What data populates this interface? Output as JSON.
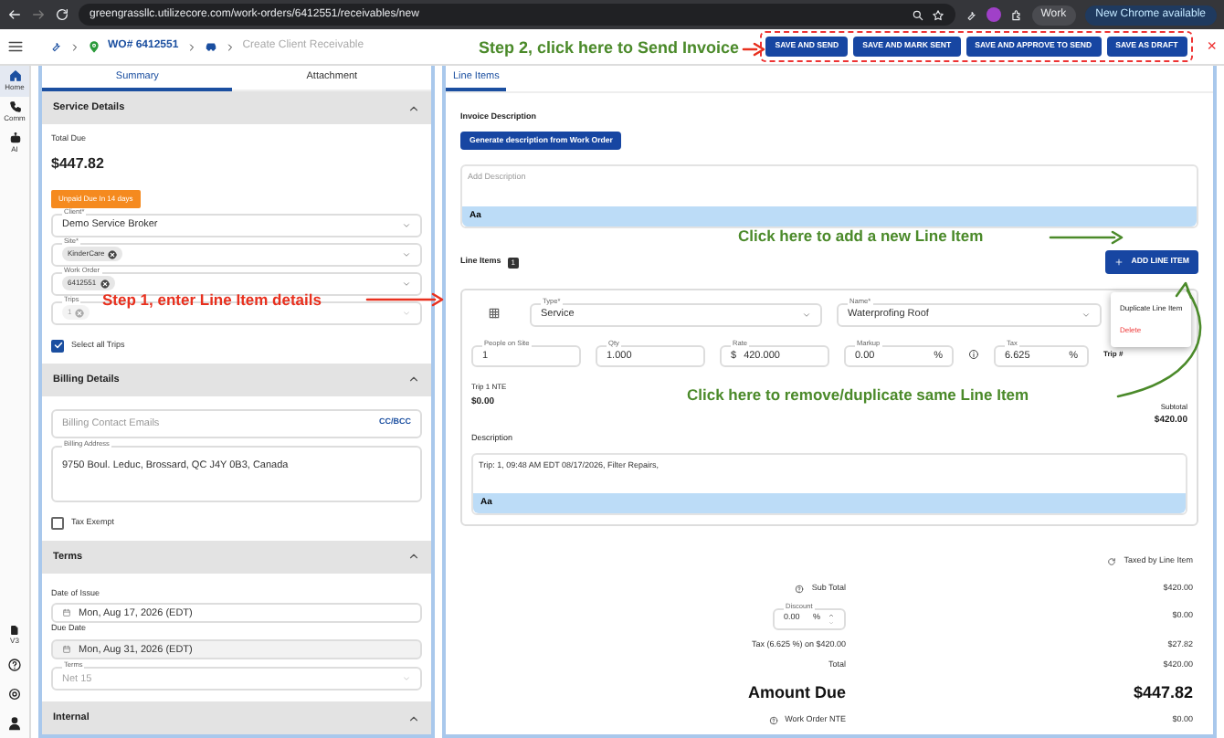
{
  "browser": {
    "url": "greengrassllc.utilizecore.com/work-orders/6412551/receivables/new",
    "profile": "Work",
    "update_button": "New Chrome available"
  },
  "breadcrumb": {
    "work_order": "WO# 6412551",
    "page": "Create Client Receivable"
  },
  "actions": [
    "SAVE AND SEND",
    "SAVE AND MARK SENT",
    "SAVE AND APPROVE TO SEND",
    "SAVE AS DRAFT"
  ],
  "close": "×",
  "rail": [
    {
      "label": "Home",
      "selected": true
    },
    {
      "label": "Comm",
      "selected": false
    },
    {
      "label": "AI",
      "selected": false
    }
  ],
  "rail_version": "V3",
  "left_tabs": [
    {
      "label": "Summary",
      "selected": true
    },
    {
      "label": "Attachment",
      "selected": false
    }
  ],
  "service_details": {
    "title": "Service Details",
    "expanded": true,
    "total_due_label": "Total Due",
    "total_due": "$447.82",
    "status_badge": "Unpaid Due In 14 days",
    "client_label": "Client*",
    "client": "Demo Service Broker",
    "site_label": "Site*",
    "site_chips": [
      "KinderCare"
    ],
    "work_order_label": "Work Order",
    "work_order_chips": [
      "6412551"
    ],
    "trips_label": "Trips",
    "trips_chips": [
      "1"
    ],
    "trips_disabled": true,
    "select_all_trips": {
      "label": "Select all Trips",
      "checked": true
    }
  },
  "billing_details": {
    "title": "Billing Details",
    "expanded": true,
    "emails_placeholder": "Billing Contact Emails",
    "cc_bcc": "CC/BCC",
    "address_label": "Billing Address",
    "address": "9750 Boul. Leduc, Brossard, QC J4Y 0B3, Canada",
    "tax_exempt": {
      "label": "Tax Exempt",
      "checked": false
    }
  },
  "terms": {
    "title": "Terms",
    "expanded": true,
    "date_of_issue_label": "Date of Issue",
    "date_of_issue": "Mon, Aug 17, 2026 (EDT)",
    "due_date_label": "Due Date",
    "due_date": "Mon, Aug 31, 2026 (EDT)",
    "terms_label": "Terms",
    "terms_value": "Net 15"
  },
  "internal": {
    "title": "Internal",
    "expanded": true
  },
  "right_tabs": [
    {
      "label": "Line Items",
      "selected": true
    }
  ],
  "invoice_description": {
    "title": "Invoice Description",
    "generate_button": "Generate description from Work Order",
    "placeholder": "Add Description",
    "format_button": "Aa"
  },
  "line_items": {
    "title": "Line Items",
    "count": "1",
    "add_button": "ADD LINE ITEM",
    "items": [
      {
        "type_label": "Type*",
        "type": "Service",
        "name_label": "Name*",
        "name": "Waterprofing Roof",
        "fields": [
          {
            "label": "People on Site",
            "value": "1"
          },
          {
            "label": "Qty",
            "value": "1.000"
          },
          {
            "label": "Rate",
            "value": "420.000",
            "prefix": "$"
          },
          {
            "label": "Markup",
            "value": "0.00",
            "suffix": "%"
          },
          {
            "label": "Tax",
            "value": "6.625",
            "suffix": "%",
            "info": true
          }
        ],
        "trip_label": "Trip #",
        "nte_label": "Trip 1 NTE",
        "nte": "$0.00",
        "subtotal_label": "Subtotal",
        "subtotal": "$420.00",
        "description_label": "Description",
        "description": "Trip: 1, 09:48 AM EDT 08/17/2026, Filter Repairs,",
        "format_button": "Aa",
        "menu": {
          "open": true,
          "options": [
            {
              "label": "Duplicate Line Item",
              "kind": "normal"
            },
            {
              "label": "Delete",
              "kind": "danger"
            }
          ]
        }
      }
    ]
  },
  "totals": {
    "taxed_by": "Taxed by Line Item",
    "rows": [
      {
        "label": "Sub Total",
        "value": "$420.00",
        "kind": "info"
      },
      {
        "label": "Discount",
        "value": "$0.00",
        "kind": "discount",
        "input": "0.00",
        "suffix": "%"
      },
      {
        "label": "Tax (6.625 %) on $420.00",
        "value": "$27.82",
        "kind": "plain"
      },
      {
        "label": "Total",
        "value": "$420.00",
        "kind": "plain"
      },
      {
        "label": "Amount Due",
        "value": "$447.82",
        "kind": "large"
      },
      {
        "label": "Work Order NTE",
        "value": "$0.00",
        "kind": "info"
      }
    ]
  },
  "annotations": [
    {
      "text": "Step 2, click here to Send Invoice",
      "kind": "step2"
    },
    {
      "text": "Step 1, enter Line Item details",
      "kind": "step1"
    },
    {
      "text": "Click here to add a new Line Item",
      "kind": "add"
    },
    {
      "text": "Click here to remove/duplicate same Line Item",
      "kind": "remove"
    }
  ]
}
